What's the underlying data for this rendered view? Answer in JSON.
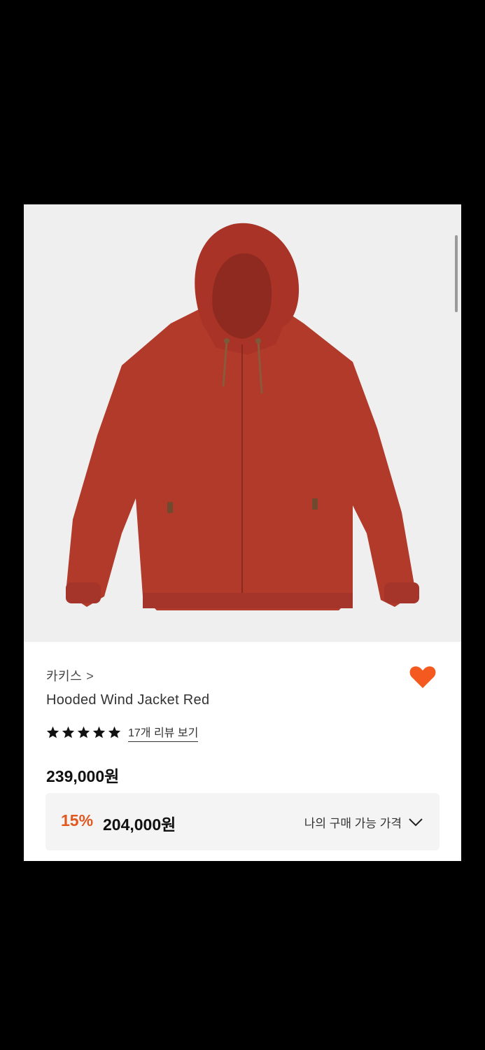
{
  "product": {
    "brand": "카키스",
    "brand_chevron": ">",
    "name": "Hooded Wind Jacket Red",
    "rating_stars": 5,
    "review_link": "17개 리뷰 보기",
    "price": "239,000원",
    "discount_rate": "15%",
    "discount_price": "204,000원",
    "my_price_label": "나의 구매 가능 가격",
    "wishlisted": true
  },
  "icons": {
    "heart": "heart-filled-icon",
    "star": "star-icon",
    "chevron_down": "chevron-down-icon",
    "brand_chevron": "chevron-right-icon"
  },
  "colors": {
    "jacket": "#b13a2a",
    "heart": "#f45a1f",
    "discount": "#e2571f",
    "photo_bg": "#efefef"
  }
}
